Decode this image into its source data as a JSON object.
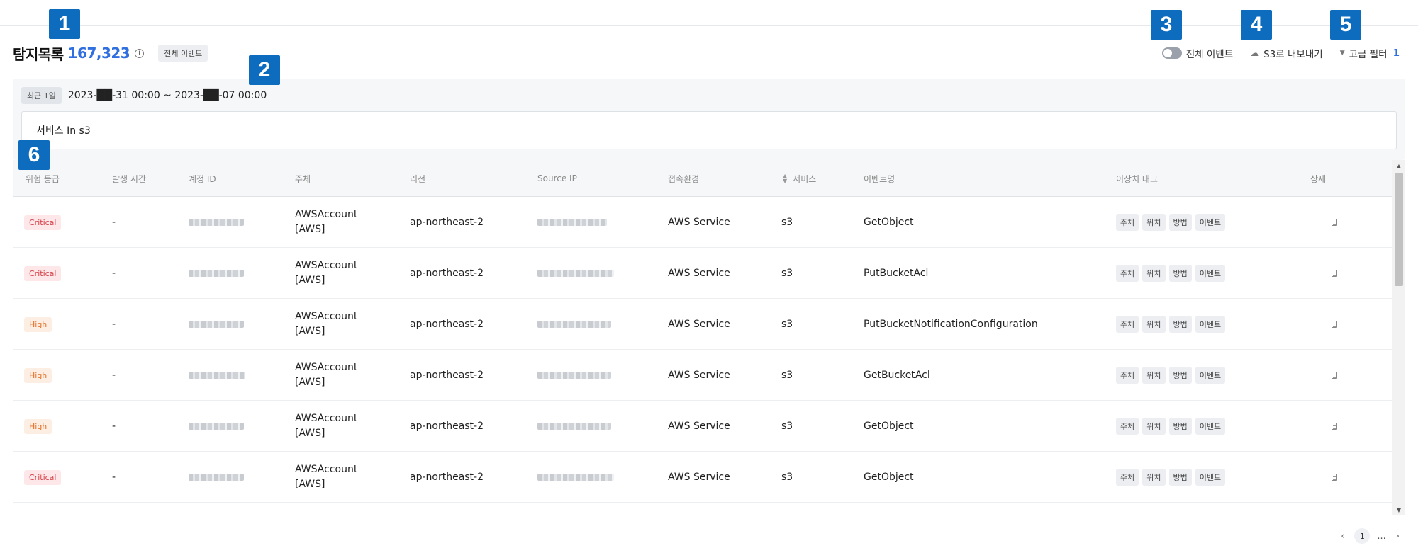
{
  "header": {
    "title": "탐지목록",
    "count": "167,323",
    "info_icon": "info-icon",
    "all_events_tag": "전체 이벤트"
  },
  "toolbar": {
    "toggle_label": "전체 이벤트",
    "toggle_on": false,
    "export_label": "S3로 내보내기",
    "export_icon": "cloud-upload-icon",
    "filter_label": "고급 필터",
    "filter_count": "1",
    "filter_icon": "filter-icon"
  },
  "filter_panel": {
    "range_chip": "최근 1일",
    "range_text": "2023-██-31 00:00 ~ 2023-██-07 00:00",
    "query": "서비스 In s3"
  },
  "table": {
    "columns": [
      "위험 등급",
      "발생 시간",
      "계정 ID",
      "주체",
      "리전",
      "Source IP",
      "접속환경",
      "서비스",
      "이벤트명",
      "이상치 태그",
      "상세"
    ],
    "tag_labels": [
      "주체",
      "위치",
      "방법",
      "이벤트"
    ],
    "rows": [
      {
        "severity": "Critical",
        "level": "critical",
        "time": "-",
        "subject_line1": "AWSAccount",
        "subject_line2": "[AWS]",
        "region": "ap-northeast-2",
        "env": "AWS Service",
        "service": "s3",
        "event": "GetObject"
      },
      {
        "severity": "Critical",
        "level": "critical",
        "time": "-",
        "subject_line1": "AWSAccount",
        "subject_line2": "[AWS]",
        "region": "ap-northeast-2",
        "env": "AWS Service",
        "service": "s3",
        "event": "PutBucketAcl"
      },
      {
        "severity": "High",
        "level": "high",
        "time": "-",
        "subject_line1": "AWSAccount",
        "subject_line2": "[AWS]",
        "region": "ap-northeast-2",
        "env": "AWS Service",
        "service": "s3",
        "event": "PutBucketNotificationConfiguration"
      },
      {
        "severity": "High",
        "level": "high",
        "time": "-",
        "subject_line1": "AWSAccount",
        "subject_line2": "[AWS]",
        "region": "ap-northeast-2",
        "env": "AWS Service",
        "service": "s3",
        "event": "GetBucketAcl"
      },
      {
        "severity": "High",
        "level": "high",
        "time": "-",
        "subject_line1": "AWSAccount",
        "subject_line2": "[AWS]",
        "region": "ap-northeast-2",
        "env": "AWS Service",
        "service": "s3",
        "event": "GetObject"
      },
      {
        "severity": "Critical",
        "level": "critical",
        "time": "-",
        "subject_line1": "AWSAccount",
        "subject_line2": "[AWS]",
        "region": "ap-northeast-2",
        "env": "AWS Service",
        "service": "s3",
        "event": "GetObject"
      }
    ]
  },
  "pagination": {
    "current": "1",
    "ellipsis": "..."
  },
  "callouts": [
    "1",
    "2",
    "3",
    "4",
    "5",
    "6"
  ],
  "colors": {
    "accent": "#2f6fe0",
    "callout": "#0d6cbd",
    "critical_bg": "#fde7e8",
    "critical_fg": "#d64049",
    "high_bg": "#fdeee3",
    "high_fg": "#e26f25"
  }
}
